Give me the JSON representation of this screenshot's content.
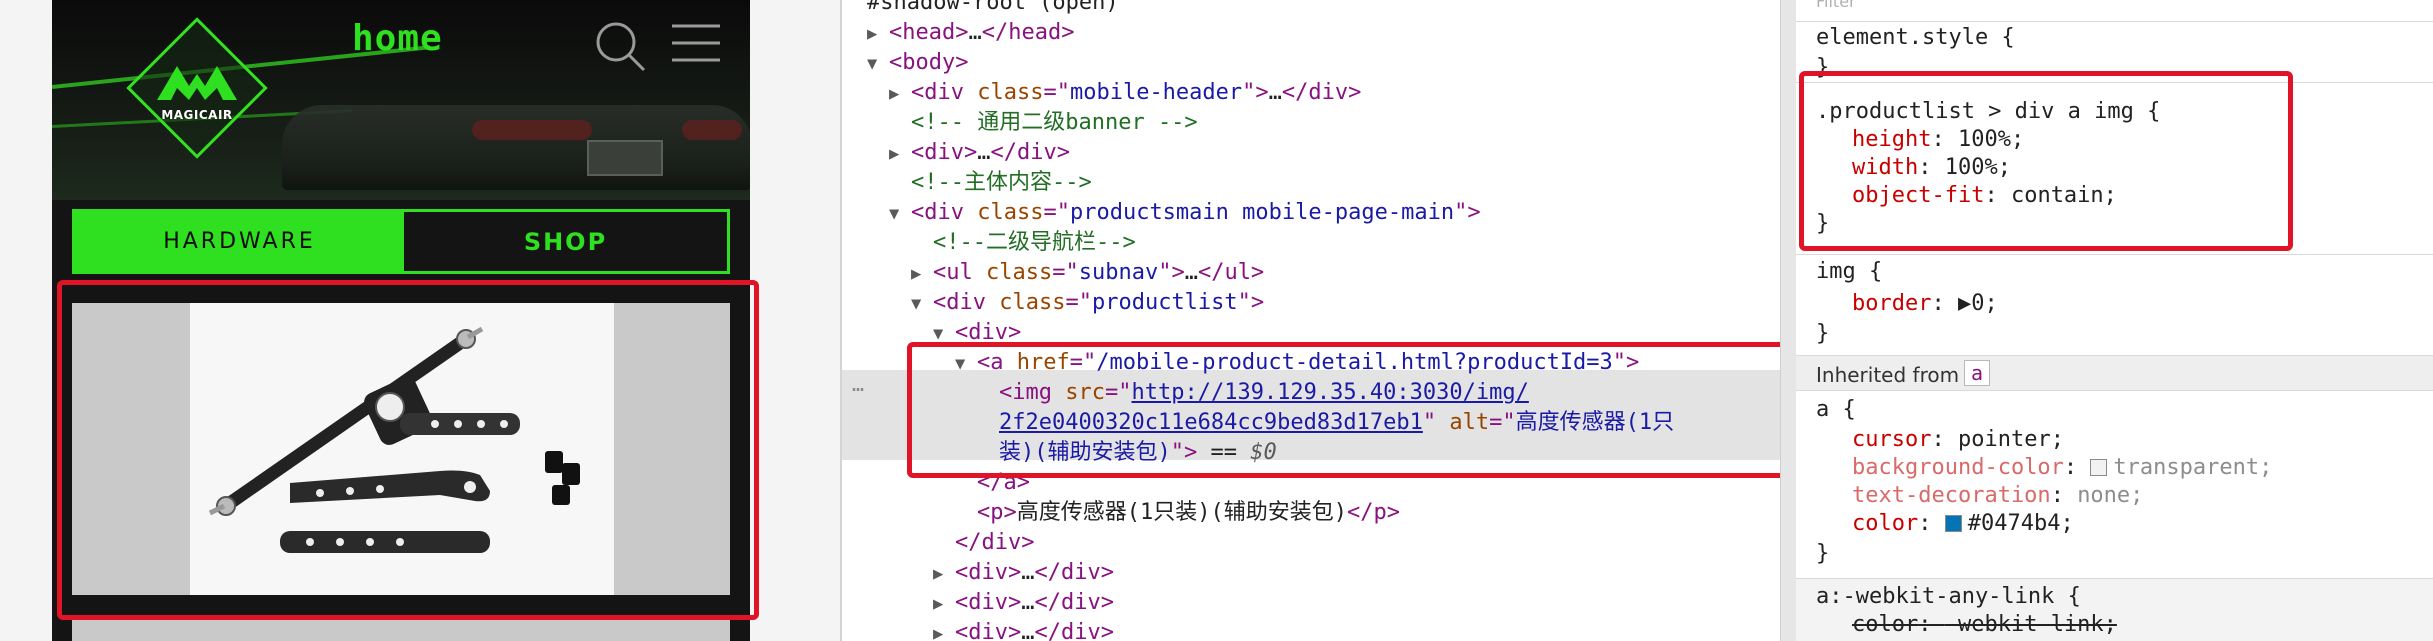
{
  "preview": {
    "header_title": "home",
    "logo_text": "MAGICAIR",
    "tabs": [
      {
        "label": "HARDWARE",
        "active": true
      },
      {
        "label": "SHOP",
        "active": false
      }
    ],
    "accent_color": "#2ee01f",
    "icons": [
      "search-icon",
      "menu-icon"
    ]
  },
  "elements": {
    "lines": [
      {
        "indent": 0,
        "tri": "",
        "parts": [
          {
            "c": "txt",
            "t": "#shadow-root (open)"
          }
        ]
      },
      {
        "indent": 1,
        "tri": "▶",
        "parts": [
          {
            "c": "tag",
            "t": "<head>"
          },
          {
            "c": "txt",
            "t": "…"
          },
          {
            "c": "tag",
            "t": "</head>"
          }
        ]
      },
      {
        "indent": 1,
        "tri": "▼",
        "parts": [
          {
            "c": "tag",
            "t": "<body>"
          }
        ]
      },
      {
        "indent": 2,
        "tri": "▶",
        "parts": [
          {
            "c": "tag",
            "t": "<div "
          },
          {
            "c": "attr",
            "t": "class"
          },
          {
            "c": "tag",
            "t": "=\""
          },
          {
            "c": "val",
            "t": "mobile-header"
          },
          {
            "c": "tag",
            "t": "\">"
          },
          {
            "c": "txt",
            "t": "…"
          },
          {
            "c": "tag",
            "t": "</div>"
          }
        ]
      },
      {
        "indent": 2,
        "tri": "",
        "parts": [
          {
            "c": "cmt",
            "t": "<!-- 通用二级banner -->"
          }
        ]
      },
      {
        "indent": 2,
        "tri": "▶",
        "parts": [
          {
            "c": "tag",
            "t": "<div>"
          },
          {
            "c": "txt",
            "t": "…"
          },
          {
            "c": "tag",
            "t": "</div>"
          }
        ]
      },
      {
        "indent": 2,
        "tri": "",
        "parts": [
          {
            "c": "cmt",
            "t": "<!--主体内容-->"
          }
        ]
      },
      {
        "indent": 2,
        "tri": "▼",
        "parts": [
          {
            "c": "tag",
            "t": "<div "
          },
          {
            "c": "attr",
            "t": "class"
          },
          {
            "c": "tag",
            "t": "=\""
          },
          {
            "c": "val",
            "t": "productsmain mobile-page-main"
          },
          {
            "c": "tag",
            "t": "\">"
          }
        ]
      },
      {
        "indent": 3,
        "tri": "",
        "parts": [
          {
            "c": "cmt",
            "t": "<!--二级导航栏-->"
          }
        ]
      },
      {
        "indent": 3,
        "tri": "▶",
        "parts": [
          {
            "c": "tag",
            "t": "<ul "
          },
          {
            "c": "attr",
            "t": "class"
          },
          {
            "c": "tag",
            "t": "=\""
          },
          {
            "c": "val",
            "t": "subnav"
          },
          {
            "c": "tag",
            "t": "\">"
          },
          {
            "c": "txt",
            "t": "…"
          },
          {
            "c": "tag",
            "t": "</ul>"
          }
        ]
      },
      {
        "indent": 3,
        "tri": "▼",
        "parts": [
          {
            "c": "tag",
            "t": "<div "
          },
          {
            "c": "attr",
            "t": "class"
          },
          {
            "c": "tag",
            "t": "=\""
          },
          {
            "c": "val",
            "t": "productlist"
          },
          {
            "c": "tag",
            "t": "\">"
          }
        ]
      },
      {
        "indent": 4,
        "tri": "▼",
        "parts": [
          {
            "c": "tag",
            "t": "<div>"
          }
        ]
      },
      {
        "indent": 5,
        "tri": "▼",
        "parts": [
          {
            "c": "tag",
            "t": "<a "
          },
          {
            "c": "attr",
            "t": "href"
          },
          {
            "c": "tag",
            "t": "=\""
          },
          {
            "c": "val",
            "t": "/mobile-product-detail.html?productId=3"
          },
          {
            "c": "tag",
            "t": "\">"
          }
        ]
      },
      {
        "indent": 6,
        "tri": "",
        "parts": [
          {
            "c": "tag",
            "t": "<img "
          },
          {
            "c": "attr",
            "t": "src"
          },
          {
            "c": "tag",
            "t": "=\""
          },
          {
            "c": "link",
            "t": "http://139.129.35.40:3030/img/"
          }
        ]
      },
      {
        "indent": 6,
        "tri": "",
        "parts": [
          {
            "c": "link",
            "t": "2f2e0400320c11e684cc9bed83d17eb1"
          },
          {
            "c": "tag",
            "t": "\" "
          },
          {
            "c": "attr",
            "t": "alt"
          },
          {
            "c": "tag",
            "t": "=\""
          },
          {
            "c": "val",
            "t": "高度传感器(1只"
          }
        ]
      },
      {
        "indent": 6,
        "tri": "",
        "parts": [
          {
            "c": "val",
            "t": "装)(辅助安装包)"
          },
          {
            "c": "tag",
            "t": "\">"
          },
          {
            "c": "txt",
            "t": " == "
          },
          {
            "c": "dim",
            "t": "$0"
          }
        ]
      },
      {
        "indent": 5,
        "tri": "",
        "parts": [
          {
            "c": "tag",
            "t": "</a>"
          }
        ]
      },
      {
        "indent": 5,
        "tri": "",
        "parts": [
          {
            "c": "tag",
            "t": "<p>"
          },
          {
            "c": "txt",
            "t": "高度传感器(1只装)(辅助安装包)"
          },
          {
            "c": "tag",
            "t": "</p>"
          }
        ]
      },
      {
        "indent": 4,
        "tri": "",
        "parts": [
          {
            "c": "tag",
            "t": "</div>"
          }
        ]
      },
      {
        "indent": 4,
        "tri": "▶",
        "parts": [
          {
            "c": "tag",
            "t": "<div>"
          },
          {
            "c": "txt",
            "t": "…"
          },
          {
            "c": "tag",
            "t": "</div>"
          }
        ]
      },
      {
        "indent": 4,
        "tri": "▶",
        "parts": [
          {
            "c": "tag",
            "t": "<div>"
          },
          {
            "c": "txt",
            "t": "…"
          },
          {
            "c": "tag",
            "t": "</div>"
          }
        ]
      },
      {
        "indent": 4,
        "tri": "▶",
        "parts": [
          {
            "c": "tag",
            "t": "<div>"
          },
          {
            "c": "txt",
            "t": "…"
          },
          {
            "c": "tag",
            "t": "</div>"
          }
        ]
      }
    ],
    "selected_marker": "…"
  },
  "styles": {
    "filter_placeholder": "Filter",
    "rules": [
      {
        "selector": "element.style {",
        "close": "}",
        "props": []
      },
      {
        "selector": ".productlist > div a img {",
        "close": "}",
        "props": [
          {
            "name": "height",
            "value": "100%;"
          },
          {
            "name": "width",
            "value": "100%;"
          },
          {
            "name": "object-fit",
            "value": "contain;"
          }
        ]
      },
      {
        "selector": "img {",
        "close": "}",
        "props": [
          {
            "name": "border",
            "value": "▶0;"
          }
        ]
      }
    ],
    "inherited_label": "Inherited from",
    "inherited_from": "a",
    "a_rule": {
      "selector": "a {",
      "close": "}",
      "props": [
        {
          "name": "cursor",
          "value": "pointer;",
          "inherited": false
        },
        {
          "name": "background-color",
          "value": "transparent;",
          "inherited": true,
          "swatch": "#ffffff"
        },
        {
          "name": "text-decoration",
          "value": "none;",
          "inherited": true
        },
        {
          "name": "color",
          "value": "#0474b4;",
          "inherited": false,
          "swatch": "#0474b4"
        }
      ]
    },
    "webkit_rule": {
      "selector": "a:-webkit-any-link {",
      "prop": "color",
      "value": "-webkit-link;"
    }
  }
}
